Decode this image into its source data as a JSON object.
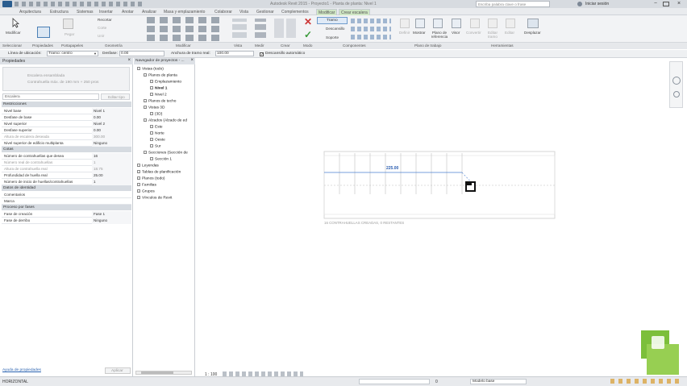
{
  "title_bar": {
    "app_title": "Autodesk Revit 2015 - Proyecto1 - Planta de planta: Nivel 1",
    "search_placeholder": "Escriba palabra clave o frase",
    "signin": "Iniciar sesión"
  },
  "ribbon_tabs": [
    "Arquitectura",
    "Estructura",
    "Sistemas",
    "Insertar",
    "Anotar",
    "Analizar",
    "Masa y emplazamiento",
    "Colaborar",
    "Vista",
    "Gestionar",
    "Complementos",
    "Modificar",
    "Crear escalera"
  ],
  "ribbon": {
    "modificar": "Modificar",
    "pegar": "Pegar",
    "recortar": "Recortar",
    "corte": "Corte",
    "unir": "Unir",
    "componentes_tramo": "Tramo",
    "componentes_descansillo": "Descansillo",
    "componentes_soporte": "Soporte",
    "definir": "Definir",
    "mostrar": "Mostrar",
    "plano_referencia": "Plano de referencia",
    "visor": "Visor",
    "convertir": "Convertir",
    "editar_tramo": "Editar tramo",
    "editar": "Editar",
    "desplazar": "Desplazar"
  },
  "ribbon_groups": [
    "Seleccionar",
    "Propiedades",
    "Portapapeles",
    "Geometría",
    "Modificar",
    "Vista",
    "Medir",
    "Crear",
    "Modo",
    "Componentes",
    "Plano de trabajo",
    "Herramientas"
  ],
  "options_bar": {
    "linea_ubicacion_label": "Línea de ubicación:",
    "linea_ubicacion_value": "Tramo: centro",
    "desfase_label": "Desfase:",
    "desfase_value": "0.00",
    "anchura_label": "Anchura de tramo real:",
    "anchura_value": "100.00",
    "descansillo_auto": "Descansillo automático"
  },
  "properties": {
    "title": "Propiedades",
    "type_name": "Escalera ensamblada",
    "type_sub": "Contrahuella máx. de 190 mm + 250 pros",
    "selector": "Escalera",
    "edit_type": "Editar tipo",
    "sections": [
      {
        "name": "Restricciones",
        "rows": [
          {
            "k": "Nivel base",
            "v": "Nivel 1"
          },
          {
            "k": "Desfase de base",
            "v": "0.00"
          },
          {
            "k": "Nivel superior",
            "v": "Nivel 2"
          },
          {
            "k": "Desfase superior",
            "v": "0.00"
          },
          {
            "k": "Altura de escalera deseada",
            "v": "300.00",
            "dim": true
          },
          {
            "k": "Nivel superior de edificio multiplanta",
            "v": "Ninguno"
          }
        ]
      },
      {
        "name": "Cotas",
        "rows": [
          {
            "k": "Número de contrahuellas que desea",
            "v": "16"
          },
          {
            "k": "Número real de contrahuellas",
            "v": "1",
            "dim": true
          },
          {
            "k": "Altura de contrahuella real",
            "v": "18.75",
            "dim": true
          },
          {
            "k": "Profundidad de huella real",
            "v": "25.00"
          },
          {
            "k": "Número de inicio de huellas/contrahuellas",
            "v": "1"
          }
        ]
      },
      {
        "name": "Datos de identidad",
        "rows": [
          {
            "k": "Comentarios",
            "v": ""
          },
          {
            "k": "Marca",
            "v": ""
          }
        ]
      },
      {
        "name": "Proceso por fases",
        "rows": [
          {
            "k": "Fase de creación",
            "v": "Fase 1"
          },
          {
            "k": "Fase de derribo",
            "v": "Ninguno"
          }
        ]
      }
    ],
    "help_link": "Ayuda de propiedades",
    "apply": "Aplicar"
  },
  "browser": {
    "title": "Navegador de proyectos - ...",
    "items": [
      {
        "t": "Vistas (todo)",
        "lvl": 0
      },
      {
        "t": "Planos de planta",
        "lvl": 1
      },
      {
        "t": "Emplazamiento",
        "lvl": 2
      },
      {
        "t": "Nivel 1",
        "lvl": 2,
        "bold": true
      },
      {
        "t": "Nivel 2",
        "lvl": 2
      },
      {
        "t": "Planos de techo",
        "lvl": 1
      },
      {
        "t": "Vistas 3D",
        "lvl": 1
      },
      {
        "t": "{3D}",
        "lvl": 2
      },
      {
        "t": "Alzados (Alzado de ed",
        "lvl": 1
      },
      {
        "t": "Este",
        "lvl": 2
      },
      {
        "t": "Norte",
        "lvl": 2
      },
      {
        "t": "Oeste",
        "lvl": 2
      },
      {
        "t": "Sur",
        "lvl": 2
      },
      {
        "t": "Secciones (Sección de",
        "lvl": 1
      },
      {
        "t": "Sección 1",
        "lvl": 2
      },
      {
        "t": "Leyendas",
        "lvl": 0
      },
      {
        "t": "Tablas de planificación",
        "lvl": 0
      },
      {
        "t": "Planos (todo)",
        "lvl": 0
      },
      {
        "t": "Familias",
        "lvl": 0
      },
      {
        "t": "Grupos",
        "lvl": 0
      },
      {
        "t": "Vínculos de Revit",
        "lvl": 0
      }
    ]
  },
  "canvas": {
    "dimension": "225.00",
    "note": "16 CONTRAHUELLAS CREADAS, 0 RESTANTES"
  },
  "status": {
    "message": "HORIZONTAL",
    "scale": "1 : 100",
    "model": "Modelo base",
    "workset_value": "0"
  }
}
